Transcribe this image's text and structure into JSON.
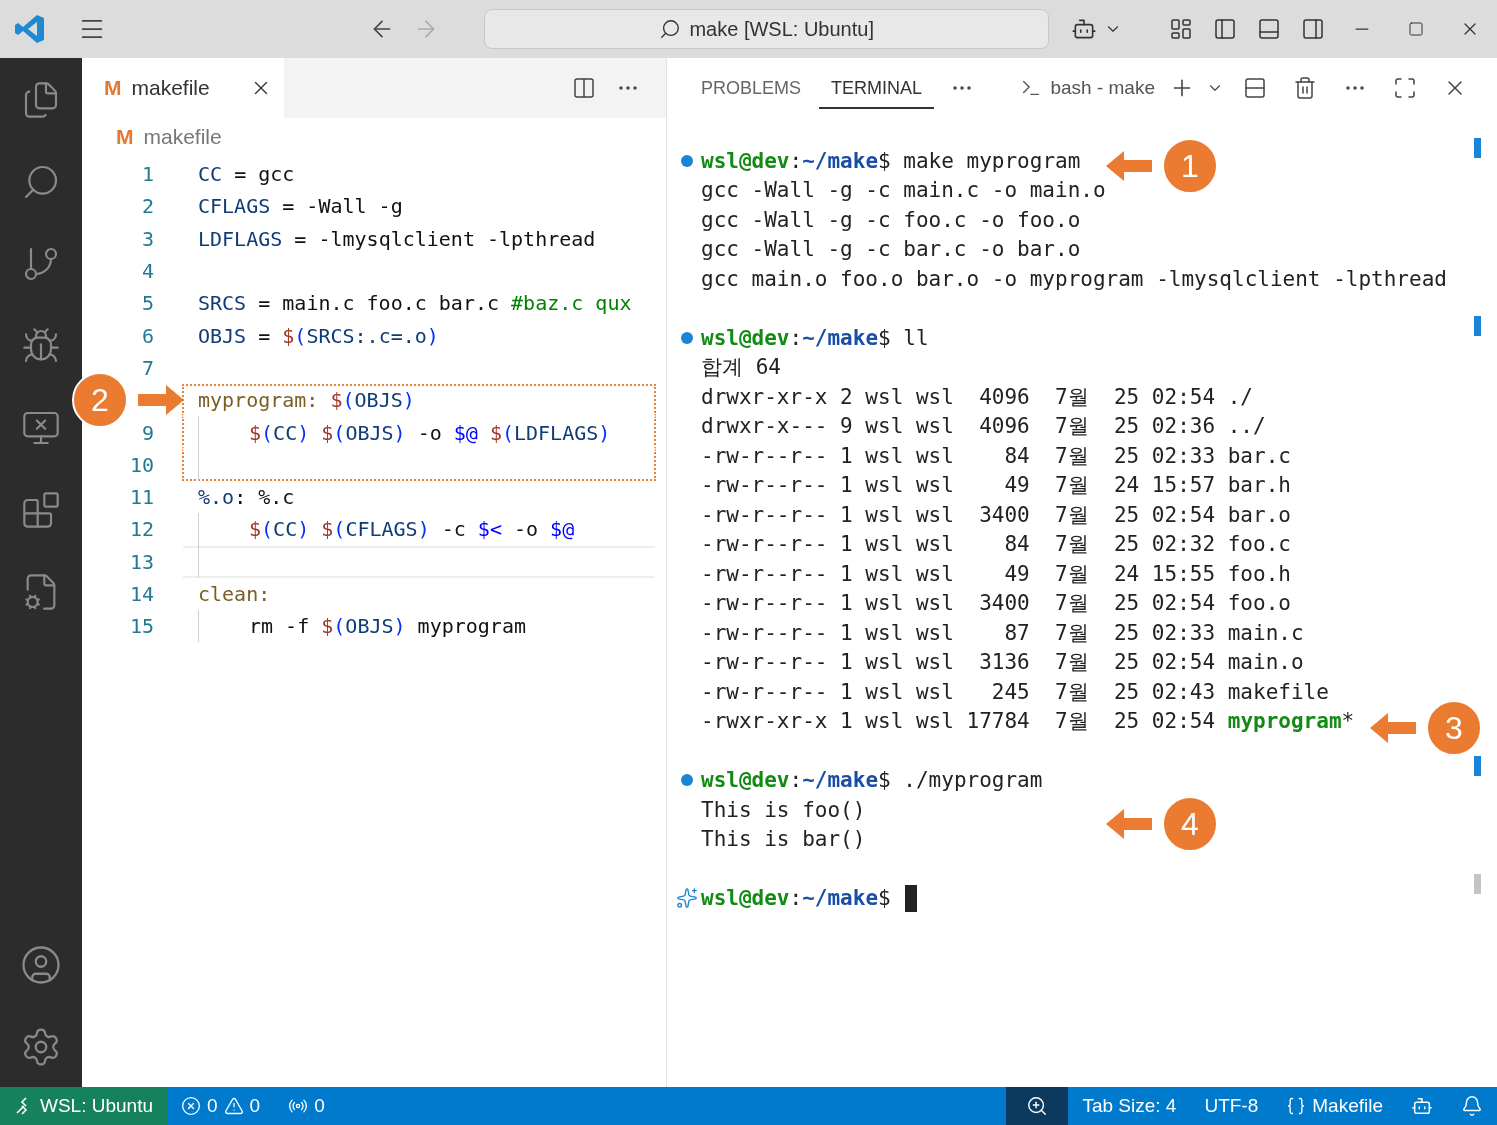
{
  "title_bar": {
    "command_center": "make [WSL: Ubuntu]"
  },
  "editor": {
    "tab": {
      "icon": "M",
      "label": "makefile",
      "selected": true
    },
    "breadcrumb": {
      "icon": "M",
      "label": "makefile"
    },
    "lines": [
      {
        "number": "1",
        "tokens": [
          {
            "kind": "var",
            "text": "CC"
          },
          {
            "kind": "plain",
            "text": " = gcc"
          }
        ]
      },
      {
        "number": "2",
        "tokens": [
          {
            "kind": "var",
            "text": "CFLAGS"
          },
          {
            "kind": "plain",
            "text": " = -Wall -g"
          }
        ]
      },
      {
        "number": "3",
        "tokens": [
          {
            "kind": "var",
            "text": "LDFLAGS"
          },
          {
            "kind": "plain",
            "text": " = -lmysqlclient -lpthread"
          }
        ]
      },
      {
        "number": "4"
      },
      {
        "number": "5",
        "tokens": [
          {
            "kind": "var",
            "text": "SRCS"
          },
          {
            "kind": "plain",
            "text": " = main.c foo.c bar.c "
          },
          {
            "kind": "comment",
            "text": "#baz.c qux"
          }
        ]
      },
      {
        "number": "6",
        "tokens": [
          {
            "kind": "var",
            "text": "OBJS"
          },
          {
            "kind": "plain",
            "text": " = "
          },
          {
            "kind": "dollar",
            "text": "$"
          },
          {
            "kind": "paren",
            "text": "("
          },
          {
            "kind": "var",
            "text": "SRCS:.c=.o"
          },
          {
            "kind": "paren",
            "text": ")"
          }
        ]
      },
      {
        "number": "7"
      },
      {
        "boxed": true,
        "tokens": [
          {
            "kind": "target",
            "text": "myprogram: "
          },
          {
            "kind": "dollar",
            "text": "$"
          },
          {
            "kind": "paren",
            "text": "("
          },
          {
            "kind": "var",
            "text": "OBJS"
          },
          {
            "kind": "paren",
            "text": ")"
          }
        ]
      },
      {
        "number": "9",
        "boxed": true,
        "indent": true,
        "tokens": [
          {
            "kind": "dollar",
            "text": "$"
          },
          {
            "kind": "paren",
            "text": "("
          },
          {
            "kind": "var",
            "text": "CC"
          },
          {
            "kind": "paren",
            "text": ") "
          },
          {
            "kind": "dollar",
            "text": "$"
          },
          {
            "kind": "paren",
            "text": "("
          },
          {
            "kind": "var",
            "text": "OBJS"
          },
          {
            "kind": "paren",
            "text": ")"
          },
          {
            "kind": "plain",
            "text": " -o "
          },
          {
            "kind": "auto",
            "text": "$@ "
          },
          {
            "kind": "dollar",
            "text": "$"
          },
          {
            "kind": "paren",
            "text": "("
          },
          {
            "kind": "var",
            "text": "LDFLAGS"
          },
          {
            "kind": "paren",
            "text": ")"
          }
        ]
      },
      {
        "number": "10",
        "boxed": true,
        "indent": true
      },
      {
        "number": "11",
        "tokens": [
          {
            "kind": "var",
            "text": "%.o"
          },
          {
            "kind": "plain",
            "text": ": %.c"
          }
        ]
      },
      {
        "number": "12",
        "indent": true,
        "tokens": [
          {
            "kind": "dollar",
            "text": "$"
          },
          {
            "kind": "paren",
            "text": "("
          },
          {
            "kind": "var",
            "text": "CC"
          },
          {
            "kind": "paren",
            "text": ") "
          },
          {
            "kind": "dollar",
            "text": "$"
          },
          {
            "kind": "paren",
            "text": "("
          },
          {
            "kind": "var",
            "text": "CFLAGS"
          },
          {
            "kind": "paren",
            "text": ")"
          },
          {
            "kind": "plain",
            "text": " -c "
          },
          {
            "kind": "auto",
            "text": "$<"
          },
          {
            "kind": "plain",
            "text": " -o "
          },
          {
            "kind": "auto",
            "text": "$@"
          }
        ]
      },
      {
        "number": "13",
        "indent": true,
        "current": true
      },
      {
        "number": "14",
        "tokens": [
          {
            "kind": "target",
            "text": "clean:"
          }
        ]
      },
      {
        "number": "15",
        "indent": true,
        "tokens": [
          {
            "kind": "plain",
            "text": "rm -f "
          },
          {
            "kind": "dollar",
            "text": "$"
          },
          {
            "kind": "paren",
            "text": "("
          },
          {
            "kind": "var",
            "text": "OBJS"
          },
          {
            "kind": "paren",
            "text": ")"
          },
          {
            "kind": "plain",
            "text": " myprogram"
          }
        ]
      }
    ]
  },
  "panel": {
    "tabs": [
      {
        "label": "PROBLEMS",
        "selected": false
      },
      {
        "label": "TERMINAL",
        "selected": true
      }
    ],
    "terminal_name": "bash - make",
    "blocks": [
      {
        "kind": "dot",
        "prompt": {
          "user": "wsl@dev",
          "sep": ":",
          "path": "~/make",
          "symbol": "$"
        },
        "command": "make myprogram",
        "output": [
          {
            "text": "gcc -Wall -g -c main.c -o main.o"
          },
          {
            "text": "gcc -Wall -g -c foo.c -o foo.o"
          },
          {
            "text": "gcc -Wall -g -c bar.c -o bar.o"
          },
          {
            "text": "gcc main.o foo.o bar.o -o myprogram -lmysqlclient -lpthread"
          }
        ]
      },
      {
        "kind": "dot",
        "prompt": {
          "user": "wsl@dev",
          "sep": ":",
          "path": "~/make",
          "symbol": "$"
        },
        "command": "ll",
        "output": [
          {
            "text": "합계 64"
          },
          {
            "text": "drwxr-xr-x 2 wsl wsl  4096  7월  25 02:54 ./"
          },
          {
            "text": "drwxr-x--- 9 wsl wsl  4096  7월  25 02:36 ../"
          },
          {
            "text": "-rw-r--r-- 1 wsl wsl    84  7월  25 02:33 bar.c"
          },
          {
            "text": "-rw-r--r-- 1 wsl wsl    49  7월  24 15:57 bar.h"
          },
          {
            "text": "-rw-r--r-- 1 wsl wsl  3400  7월  25 02:54 bar.o"
          },
          {
            "text": "-rw-r--r-- 1 wsl wsl    84  7월  25 02:32 foo.c"
          },
          {
            "text": "-rw-r--r-- 1 wsl wsl    49  7월  24 15:55 foo.h"
          },
          {
            "text": "-rw-r--r-- 1 wsl wsl  3400  7월  25 02:54 foo.o"
          },
          {
            "text": "-rw-r--r-- 1 wsl wsl    87  7월  25 02:33 main.c"
          },
          {
            "text": "-rw-r--r-- 1 wsl wsl  3136  7월  25 02:54 main.o"
          },
          {
            "text": "-rw-r--r-- 1 wsl wsl   245  7월  25 02:43 makefile"
          },
          {
            "text": "-rwxr-xr-x 1 wsl wsl 17784  7월  25 02:54 ",
            "exec": "myprogram",
            "suffix": "*"
          }
        ]
      },
      {
        "kind": "dot",
        "prompt": {
          "user": "wsl@dev",
          "sep": ":",
          "path": "~/make",
          "symbol": "$"
        },
        "command": "./myprogram",
        "output": [
          {
            "text": "This is foo()"
          },
          {
            "text": "This is bar()"
          }
        ]
      },
      {
        "kind": "sparkle",
        "prompt": {
          "user": "wsl@dev",
          "sep": ":",
          "path": "~/make",
          "symbol": "$"
        },
        "cursor": true
      }
    ]
  },
  "callouts": [
    {
      "number": "1",
      "kind": "left"
    },
    {
      "number": "2",
      "kind": "right"
    },
    {
      "number": "3",
      "kind": "left"
    },
    {
      "number": "4",
      "kind": "left"
    }
  ],
  "status_bar": {
    "remote": "WSL: Ubuntu",
    "errors": "0",
    "warnings": "0",
    "ports": "0",
    "tab_size": "Tab Size: 4",
    "encoding": "UTF-8",
    "language": "Makefile"
  }
}
